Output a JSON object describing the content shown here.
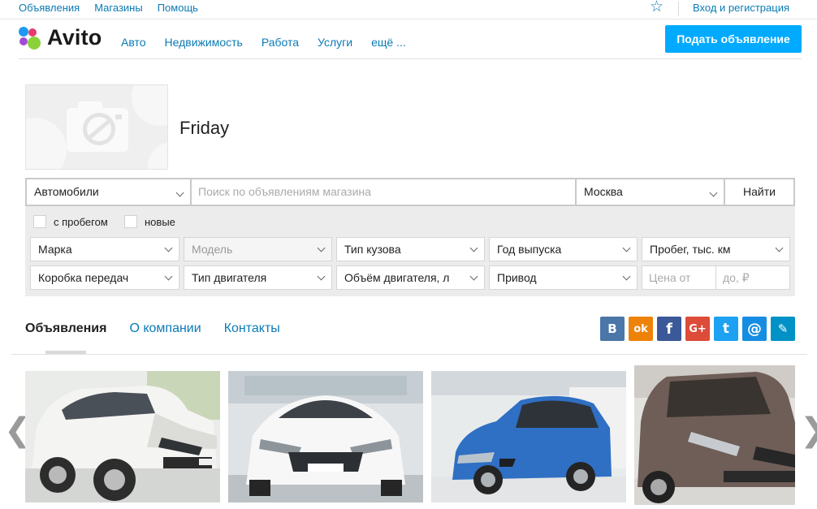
{
  "topbar": {
    "links": [
      "Объявления",
      "Магазины",
      "Помощь"
    ],
    "login": "Вход и регистрация",
    "favorites_icon": "star-icon"
  },
  "header": {
    "logo": "Avito",
    "nav": [
      "Авто",
      "Недвижимость",
      "Работа",
      "Услуги",
      "ещё ..."
    ],
    "post_button": "Подать объявление",
    "accent_color": "#00aaff",
    "link_color": "#0a7bb4"
  },
  "shop": {
    "name": "Friday",
    "photo_icon": "camera-placeholder-icon"
  },
  "search": {
    "category": "Автомобили",
    "query_placeholder": "Поиск по объявлениям магазина",
    "city": "Москва",
    "find_button": "Найти",
    "checkbox_mileage": "с пробегом",
    "checkbox_new": "новые",
    "filters_row1": [
      "Марка",
      "Модель",
      "Тип кузова",
      "Год выпуска",
      "Пробег, тыс. км"
    ],
    "filters_row2": [
      "Коробка передач",
      "Тип двигателя",
      "Объём двигателя, л",
      "Привод"
    ],
    "price_from": "Цена от",
    "price_to": "до, ₽"
  },
  "tabs": {
    "items": [
      "Объявления",
      "О компании",
      "Контакты"
    ],
    "active": 0
  },
  "social": [
    {
      "icon": "vk-icon",
      "label": "В",
      "color": "#4a76a8"
    },
    {
      "icon": "odnoklassniki-icon",
      "label": "ok",
      "color": "#ee8208"
    },
    {
      "icon": "facebook-icon",
      "label": "f",
      "color": "#3b5998"
    },
    {
      "icon": "google-plus-icon",
      "label": "G+",
      "color": "#dd4b39"
    },
    {
      "icon": "twitter-icon",
      "label": "t",
      "color": "#1da1f2"
    },
    {
      "icon": "mail-icon",
      "label": "@",
      "color": "#168de2"
    },
    {
      "icon": "livejournal-icon",
      "label": "✎",
      "color": "#0091c6"
    }
  ],
  "gallery": {
    "prev": "❮",
    "next": "❯"
  }
}
